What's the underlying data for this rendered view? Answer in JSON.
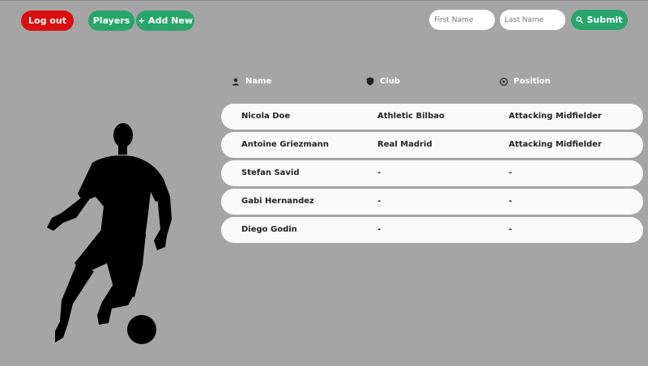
{
  "nav": {
    "logout_label": "Log out",
    "players_label": "Players",
    "add_new_label": "+ Add New"
  },
  "search": {
    "first_name_placeholder": "First Name",
    "last_name_placeholder": "Last Name",
    "submit_label": "Submit",
    "submit_icon": "search-icon"
  },
  "table": {
    "columns": [
      {
        "label": "Name",
        "icon": "person-icon"
      },
      {
        "label": "Club",
        "icon": "shield-icon"
      },
      {
        "label": "Position",
        "icon": "soccer-ball-icon"
      }
    ],
    "rows": [
      {
        "name": "Nicola Doe",
        "club": "Athletic Bilbao",
        "position": "Attacking Midfielder"
      },
      {
        "name": "Antoine Griezmann",
        "club": "Real Madrid",
        "position": "Attacking Midfielder"
      },
      {
        "name": "Stefan Savid",
        "club": "-",
        "position": "-"
      },
      {
        "name": "Gabi Hernandez",
        "club": "-",
        "position": "-"
      },
      {
        "name": "Diego Godin",
        "club": "-",
        "position": "-"
      }
    ]
  },
  "colors": {
    "background": "#a5a5a5",
    "logout": "#d90f0f",
    "accent": "#27a56a",
    "row": "#fafafa"
  }
}
